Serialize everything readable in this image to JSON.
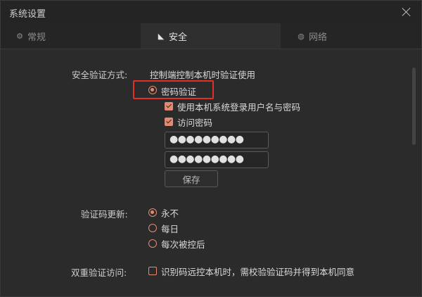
{
  "window": {
    "title": "系统设置"
  },
  "tabs": [
    {
      "label": "常规",
      "icon": "gear-icon"
    },
    {
      "label": "安全",
      "icon": "shield-icon"
    },
    {
      "label": "网络",
      "icon": "globe-icon"
    }
  ],
  "security": {
    "auth_method_label": "安全验证方式:",
    "auth_method_desc": "控制端控制本机时验证使用",
    "password_auth_label": "密码验证",
    "use_system_login_label": "使用本机系统登录用户名与密码",
    "access_password_label": "访问密码",
    "password1_value": "●●●●●●●●●",
    "password2_value": "●●●●●●●●●",
    "save_button": "保存",
    "code_update_label": "验证码更新:",
    "code_options": [
      "永不",
      "每日",
      "每次被控后"
    ],
    "dual_auth_label": "双重验证访问:",
    "dual_auth_desc": "识别码远控本机时，需校验验证码并得到本机同意"
  },
  "colors": {
    "accent": "#e58a72",
    "highlight": "#e0302a",
    "background": "#2b2b2b"
  }
}
